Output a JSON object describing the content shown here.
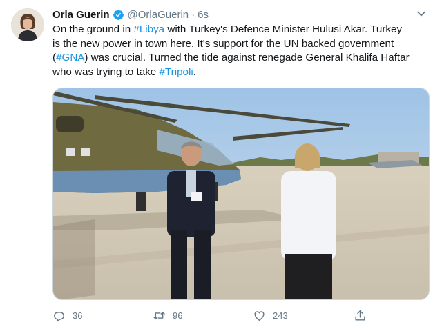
{
  "tweet": {
    "author_name": "Orla Guerin",
    "handle": "@OrlaGuerin",
    "separator": "·",
    "time": "6s",
    "text_lines": [
      [
        {
          "t": "On the ground in ",
          "tag": false
        },
        {
          "t": "#Libya",
          "tag": true
        },
        {
          "t": " with Turkey's Defence Minister Hulusi Akar.  Turkey",
          "tag": false
        }
      ],
      [
        {
          "t": "is the new power in town here. It's support for the UN backed government",
          "tag": false
        }
      ],
      [
        {
          "t": "(",
          "tag": false
        },
        {
          "t": "#GNA",
          "tag": true
        },
        {
          "t": ") was crucial.  Turned the tide against renegade General Khalifa Haftar",
          "tag": false
        }
      ],
      [
        {
          "t": "who was trying to take ",
          "tag": false
        },
        {
          "t": "#Tripoli",
          "tag": true
        },
        {
          "t": ".",
          "tag": false
        }
      ]
    ],
    "actions": {
      "reply_count": "36",
      "retweet_count": "96",
      "like_count": "243",
      "share_label": ""
    }
  },
  "icons": {
    "verified": "verified-badge-icon",
    "caret": "chevron-down-icon",
    "reply": "reply-icon",
    "retweet": "retweet-icon",
    "like": "heart-icon",
    "share": "share-icon"
  },
  "colors": {
    "link": "#1b95e0",
    "secondary_text": "#657786",
    "verified_badge": "#1da1f2"
  }
}
